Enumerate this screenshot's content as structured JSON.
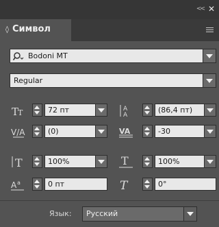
{
  "panel": {
    "title": "Символ",
    "tab_marker": "◊",
    "collapse_glyph": "<<",
    "close_glyph": "✕"
  },
  "font_family": {
    "value": "Bodoni MT",
    "search_icon": "search-icon"
  },
  "font_style": {
    "value": "Regular"
  },
  "fields": {
    "size": {
      "value": "72 пт",
      "icon": "font-size-icon"
    },
    "leading": {
      "value": "(86,4 пт)",
      "icon": "leading-icon"
    },
    "kerning": {
      "value": "(0)",
      "icon": "kerning-icon"
    },
    "tracking": {
      "value": "-30",
      "icon": "tracking-icon"
    },
    "vertical_scale": {
      "value": "100%",
      "icon": "vertical-scale-icon"
    },
    "horizontal_scale": {
      "value": "100%",
      "icon": "horizontal-scale-icon"
    },
    "baseline_shift": {
      "value": "0 пт",
      "icon": "baseline-shift-icon"
    },
    "skew": {
      "value": "0°",
      "icon": "skew-icon"
    }
  },
  "language": {
    "label": "Язык:",
    "value": "Русский"
  }
}
